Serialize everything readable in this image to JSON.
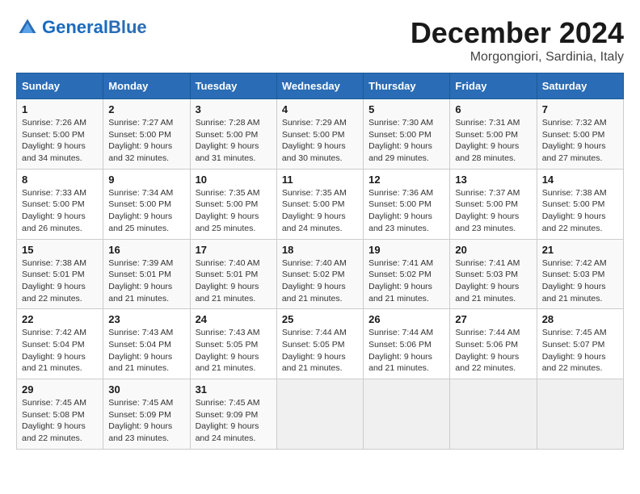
{
  "header": {
    "logo_general": "General",
    "logo_blue": "Blue",
    "month": "December 2024",
    "location": "Morgongiori, Sardinia, Italy"
  },
  "weekdays": [
    "Sunday",
    "Monday",
    "Tuesday",
    "Wednesday",
    "Thursday",
    "Friday",
    "Saturday"
  ],
  "weeks": [
    [
      {
        "day": "1",
        "sunrise": "Sunrise: 7:26 AM",
        "sunset": "Sunset: 5:00 PM",
        "daylight": "Daylight: 9 hours and 34 minutes."
      },
      {
        "day": "2",
        "sunrise": "Sunrise: 7:27 AM",
        "sunset": "Sunset: 5:00 PM",
        "daylight": "Daylight: 9 hours and 32 minutes."
      },
      {
        "day": "3",
        "sunrise": "Sunrise: 7:28 AM",
        "sunset": "Sunset: 5:00 PM",
        "daylight": "Daylight: 9 hours and 31 minutes."
      },
      {
        "day": "4",
        "sunrise": "Sunrise: 7:29 AM",
        "sunset": "Sunset: 5:00 PM",
        "daylight": "Daylight: 9 hours and 30 minutes."
      },
      {
        "day": "5",
        "sunrise": "Sunrise: 7:30 AM",
        "sunset": "Sunset: 5:00 PM",
        "daylight": "Daylight: 9 hours and 29 minutes."
      },
      {
        "day": "6",
        "sunrise": "Sunrise: 7:31 AM",
        "sunset": "Sunset: 5:00 PM",
        "daylight": "Daylight: 9 hours and 28 minutes."
      },
      {
        "day": "7",
        "sunrise": "Sunrise: 7:32 AM",
        "sunset": "Sunset: 5:00 PM",
        "daylight": "Daylight: 9 hours and 27 minutes."
      }
    ],
    [
      {
        "day": "8",
        "sunrise": "Sunrise: 7:33 AM",
        "sunset": "Sunset: 5:00 PM",
        "daylight": "Daylight: 9 hours and 26 minutes."
      },
      {
        "day": "9",
        "sunrise": "Sunrise: 7:34 AM",
        "sunset": "Sunset: 5:00 PM",
        "daylight": "Daylight: 9 hours and 25 minutes."
      },
      {
        "day": "10",
        "sunrise": "Sunrise: 7:35 AM",
        "sunset": "Sunset: 5:00 PM",
        "daylight": "Daylight: 9 hours and 25 minutes."
      },
      {
        "day": "11",
        "sunrise": "Sunrise: 7:35 AM",
        "sunset": "Sunset: 5:00 PM",
        "daylight": "Daylight: 9 hours and 24 minutes."
      },
      {
        "day": "12",
        "sunrise": "Sunrise: 7:36 AM",
        "sunset": "Sunset: 5:00 PM",
        "daylight": "Daylight: 9 hours and 23 minutes."
      },
      {
        "day": "13",
        "sunrise": "Sunrise: 7:37 AM",
        "sunset": "Sunset: 5:00 PM",
        "daylight": "Daylight: 9 hours and 23 minutes."
      },
      {
        "day": "14",
        "sunrise": "Sunrise: 7:38 AM",
        "sunset": "Sunset: 5:00 PM",
        "daylight": "Daylight: 9 hours and 22 minutes."
      }
    ],
    [
      {
        "day": "15",
        "sunrise": "Sunrise: 7:38 AM",
        "sunset": "Sunset: 5:01 PM",
        "daylight": "Daylight: 9 hours and 22 minutes."
      },
      {
        "day": "16",
        "sunrise": "Sunrise: 7:39 AM",
        "sunset": "Sunset: 5:01 PM",
        "daylight": "Daylight: 9 hours and 21 minutes."
      },
      {
        "day": "17",
        "sunrise": "Sunrise: 7:40 AM",
        "sunset": "Sunset: 5:01 PM",
        "daylight": "Daylight: 9 hours and 21 minutes."
      },
      {
        "day": "18",
        "sunrise": "Sunrise: 7:40 AM",
        "sunset": "Sunset: 5:02 PM",
        "daylight": "Daylight: 9 hours and 21 minutes."
      },
      {
        "day": "19",
        "sunrise": "Sunrise: 7:41 AM",
        "sunset": "Sunset: 5:02 PM",
        "daylight": "Daylight: 9 hours and 21 minutes."
      },
      {
        "day": "20",
        "sunrise": "Sunrise: 7:41 AM",
        "sunset": "Sunset: 5:03 PM",
        "daylight": "Daylight: 9 hours and 21 minutes."
      },
      {
        "day": "21",
        "sunrise": "Sunrise: 7:42 AM",
        "sunset": "Sunset: 5:03 PM",
        "daylight": "Daylight: 9 hours and 21 minutes."
      }
    ],
    [
      {
        "day": "22",
        "sunrise": "Sunrise: 7:42 AM",
        "sunset": "Sunset: 5:04 PM",
        "daylight": "Daylight: 9 hours and 21 minutes."
      },
      {
        "day": "23",
        "sunrise": "Sunrise: 7:43 AM",
        "sunset": "Sunset: 5:04 PM",
        "daylight": "Daylight: 9 hours and 21 minutes."
      },
      {
        "day": "24",
        "sunrise": "Sunrise: 7:43 AM",
        "sunset": "Sunset: 5:05 PM",
        "daylight": "Daylight: 9 hours and 21 minutes."
      },
      {
        "day": "25",
        "sunrise": "Sunrise: 7:44 AM",
        "sunset": "Sunset: 5:05 PM",
        "daylight": "Daylight: 9 hours and 21 minutes."
      },
      {
        "day": "26",
        "sunrise": "Sunrise: 7:44 AM",
        "sunset": "Sunset: 5:06 PM",
        "daylight": "Daylight: 9 hours and 21 minutes."
      },
      {
        "day": "27",
        "sunrise": "Sunrise: 7:44 AM",
        "sunset": "Sunset: 5:06 PM",
        "daylight": "Daylight: 9 hours and 22 minutes."
      },
      {
        "day": "28",
        "sunrise": "Sunrise: 7:45 AM",
        "sunset": "Sunset: 5:07 PM",
        "daylight": "Daylight: 9 hours and 22 minutes."
      }
    ],
    [
      {
        "day": "29",
        "sunrise": "Sunrise: 7:45 AM",
        "sunset": "Sunset: 5:08 PM",
        "daylight": "Daylight: 9 hours and 22 minutes."
      },
      {
        "day": "30",
        "sunrise": "Sunrise: 7:45 AM",
        "sunset": "Sunset: 5:09 PM",
        "daylight": "Daylight: 9 hours and 23 minutes."
      },
      {
        "day": "31",
        "sunrise": "Sunrise: 7:45 AM",
        "sunset": "Sunset: 9:09 PM",
        "daylight": "Daylight: 9 hours and 24 minutes."
      },
      null,
      null,
      null,
      null
    ]
  ]
}
